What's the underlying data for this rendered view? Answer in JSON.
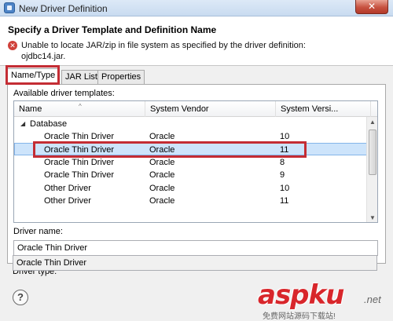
{
  "window": {
    "title": "New Driver Definition",
    "close_glyph": "✕"
  },
  "header": {
    "heading": "Specify a Driver Template and Definition Name",
    "error_icon": "error-icon",
    "error_line1": "Unable to locate JAR/zip in file system as specified by the driver definition:",
    "error_line2": "ojdbc14.jar."
  },
  "tabs": [
    {
      "label": "Name/Type",
      "active": true
    },
    {
      "label": "JAR List",
      "active": false
    },
    {
      "label": "Properties",
      "active": false
    }
  ],
  "templates": {
    "label": "Available driver templates:",
    "columns": [
      "Name",
      "System Vendor",
      "System Versi..."
    ],
    "group": "Database",
    "rows": [
      {
        "name": "Oracle Thin Driver",
        "vendor": "Oracle",
        "version": "10",
        "selected": false
      },
      {
        "name": "Oracle Thin Driver",
        "vendor": "Oracle",
        "version": "11",
        "selected": true
      },
      {
        "name": "Oracle Thin Driver",
        "vendor": "Oracle",
        "version": "8",
        "selected": false
      },
      {
        "name": "Oracle Thin Driver",
        "vendor": "Oracle",
        "version": "9",
        "selected": false
      },
      {
        "name": "Other Driver",
        "vendor": "Oracle",
        "version": "10",
        "selected": false
      },
      {
        "name": "Other Driver",
        "vendor": "Oracle",
        "version": "11",
        "selected": false
      }
    ]
  },
  "driver_name": {
    "label": "Driver name:",
    "value": "Oracle Thin Driver"
  },
  "driver_type": {
    "label": "Driver type:",
    "value": "Oracle Thin Driver"
  },
  "footer": {
    "help_glyph": "?"
  },
  "watermark": {
    "main": "aspku",
    "sub": "免费网站源码下载站!",
    "net": ".net"
  },
  "colors": {
    "highlight": "#c42d34",
    "selection": "#cde4fb",
    "error": "#d0413a"
  }
}
